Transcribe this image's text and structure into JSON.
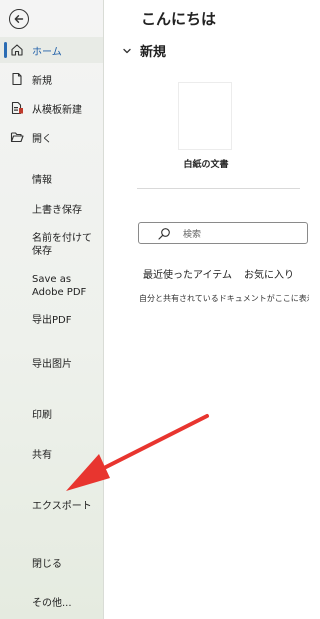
{
  "sidebar": {
    "primary_items": [
      {
        "label": "ホーム",
        "icon": "home-icon",
        "active": true
      },
      {
        "label": "新規",
        "icon": "new-document-icon"
      },
      {
        "label": "从模板新建",
        "icon": "template-icon"
      },
      {
        "label": "開く",
        "icon": "open-folder-icon"
      }
    ],
    "text_items": [
      {
        "label": "情報"
      },
      {
        "label": "上書き保存"
      },
      {
        "label": "名前を付けて\n保存"
      },
      {
        "label": "Save as\nAdobe PDF"
      },
      {
        "label": "导出PDF"
      },
      {
        "label": "导出图片"
      },
      {
        "label": "印刷"
      },
      {
        "label": "共有"
      },
      {
        "label": "エクスポート"
      },
      {
        "label": "閉じる"
      },
      {
        "label": "その他..."
      }
    ]
  },
  "main": {
    "greeting": "こんにちは",
    "new_section_title": "新規",
    "template_label": "白紙の文書",
    "search_placeholder": "検索",
    "tabs": [
      {
        "label": "最近使ったアイテム"
      },
      {
        "label": "お気に入り"
      }
    ],
    "info_text": "自分と共有されているドキュメントがここに表示されます"
  },
  "colors": {
    "accent": "#2b6cb3",
    "annotation_arrow": "#e8352f"
  }
}
